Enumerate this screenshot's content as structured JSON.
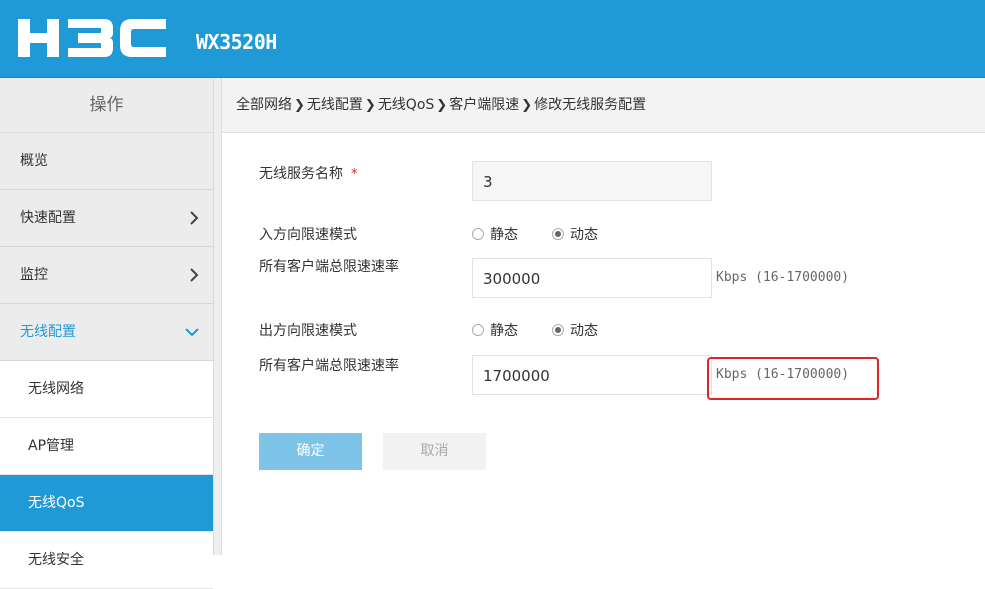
{
  "header": {
    "brand": "H3C",
    "model": "WX3520H",
    "bg_color": "#1f9ad6"
  },
  "sidebar": {
    "title": "操作",
    "items": [
      {
        "label": "概览",
        "chevron": ""
      },
      {
        "label": "快速配置",
        "chevron": "›"
      },
      {
        "label": "监控",
        "chevron": "›"
      },
      {
        "label": "无线配置",
        "chevron": "⌄"
      }
    ],
    "sub_items": [
      {
        "label": "无线网络"
      },
      {
        "label": "AP管理"
      },
      {
        "label": "无线QoS"
      },
      {
        "label": "无线安全"
      }
    ]
  },
  "breadcrumb": [
    "全部网络",
    "无线配置",
    "无线QoS",
    "客户端限速",
    "修改无线服务配置"
  ],
  "breadcrumb_sep": "❯",
  "form": {
    "service_name_label": "无线服务名称",
    "required_mark": "*",
    "service_name_value": "3",
    "inbound_mode_label": "入方向限速模式",
    "inbound_static": "静态",
    "inbound_dynamic": "动态",
    "inbound_selected": "动态",
    "inbound_rate_label": "所有客户端总限速速率",
    "inbound_rate_value": "300000",
    "inbound_unit": "Kbps (16-1700000)",
    "outbound_mode_label": "出方向限速模式",
    "outbound_static": "静态",
    "outbound_dynamic": "动态",
    "outbound_selected": "动态",
    "outbound_rate_label": "所有客户端总限速速率",
    "outbound_rate_value": "1700000",
    "outbound_unit": "Kbps (16-1700000)"
  },
  "buttons": {
    "ok": "确定",
    "cancel": "取消"
  },
  "icons": {
    "chevron_right": "chevron-right-icon",
    "chevron_down": "chevron-down-icon"
  },
  "colors": {
    "accent": "#1f9ad6",
    "highlight": "#e0242b",
    "required": "#d9232d"
  }
}
